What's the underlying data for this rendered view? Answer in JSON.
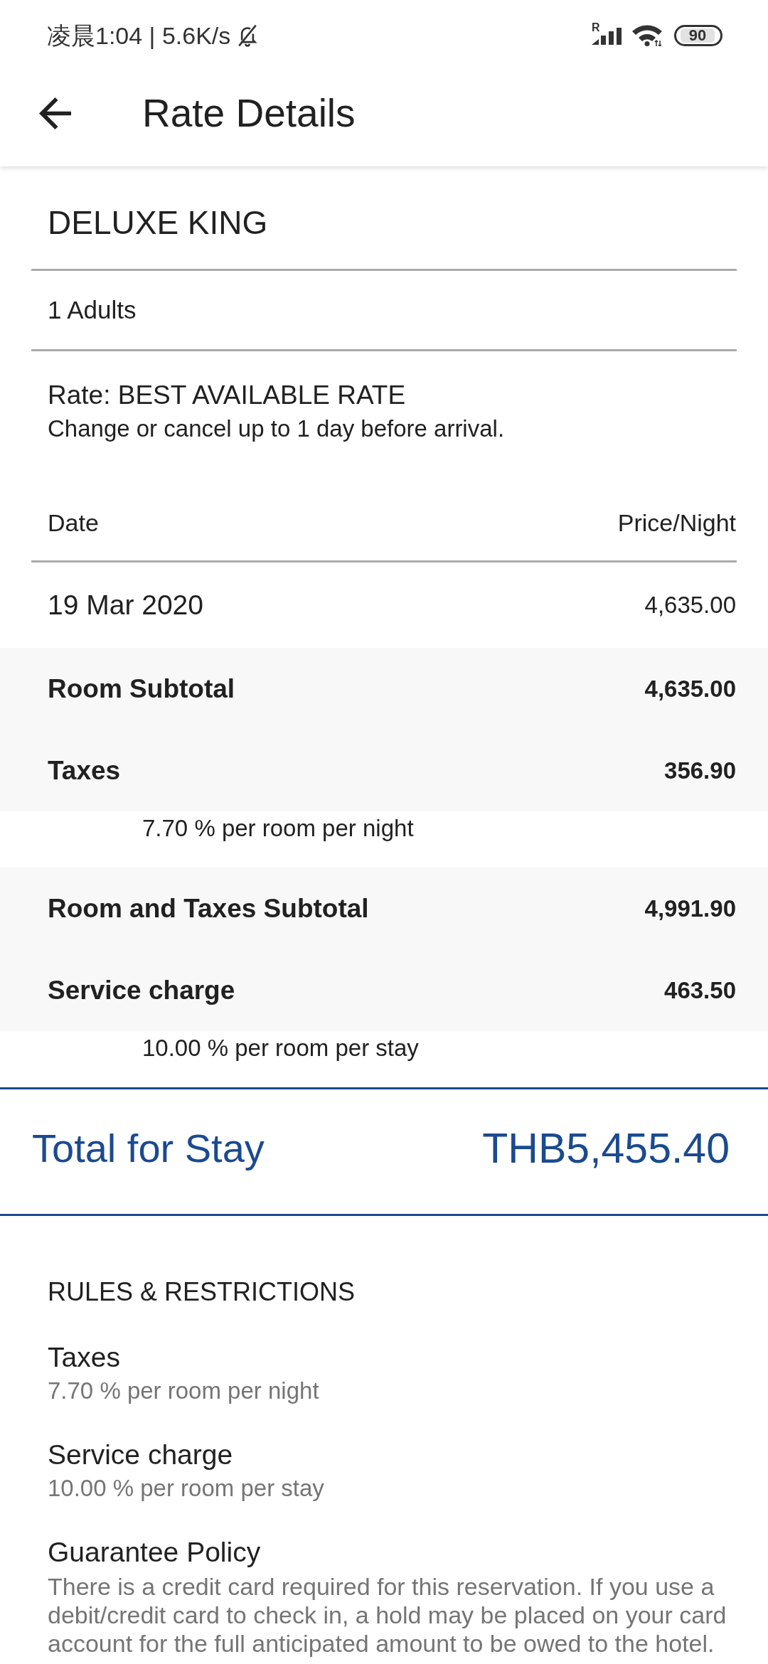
{
  "status_bar": {
    "text": "凌晨1:04 | 5.6K/s",
    "network_label": "R",
    "battery": "90"
  },
  "app_bar": {
    "title": "Rate Details"
  },
  "room": {
    "name": "DELUXE KING",
    "guests": "1 Adults",
    "rate": "Rate: BEST AVAILABLE RATE",
    "rate_note": "Change or cancel up to 1 day before arrival."
  },
  "nightly_rates": {
    "columns": [
      "Date",
      "Price/Night"
    ],
    "rows": [
      {
        "date": "19 Mar 2020",
        "price": "4,635.00"
      }
    ]
  },
  "charges": [
    {
      "label": "Room Subtotal",
      "amount": "4,635.00"
    },
    {
      "label": "Taxes",
      "amount": "356.90",
      "note": "7.70 % per room per night"
    },
    {
      "label": "Room and Taxes Subtotal",
      "amount": "4,991.90"
    },
    {
      "label": "Service charge",
      "amount": "463.50",
      "note": "10.00 % per room per stay"
    }
  ],
  "total": {
    "label": "Total for Stay",
    "amount": "THB5,455.40"
  },
  "rules": {
    "title": "RULES & RESTRICTIONS",
    "items": [
      {
        "title": "Taxes",
        "text": "7.70 % per room per night"
      },
      {
        "title": "Service charge",
        "text": "10.00 % per room per stay"
      },
      {
        "title": "Guarantee Policy",
        "text": "There is a credit card required for this reservation. If you use a debit/credit card to check in, a hold may be placed on your card account for the full anticipated amount to be owed to the hotel."
      }
    ]
  }
}
